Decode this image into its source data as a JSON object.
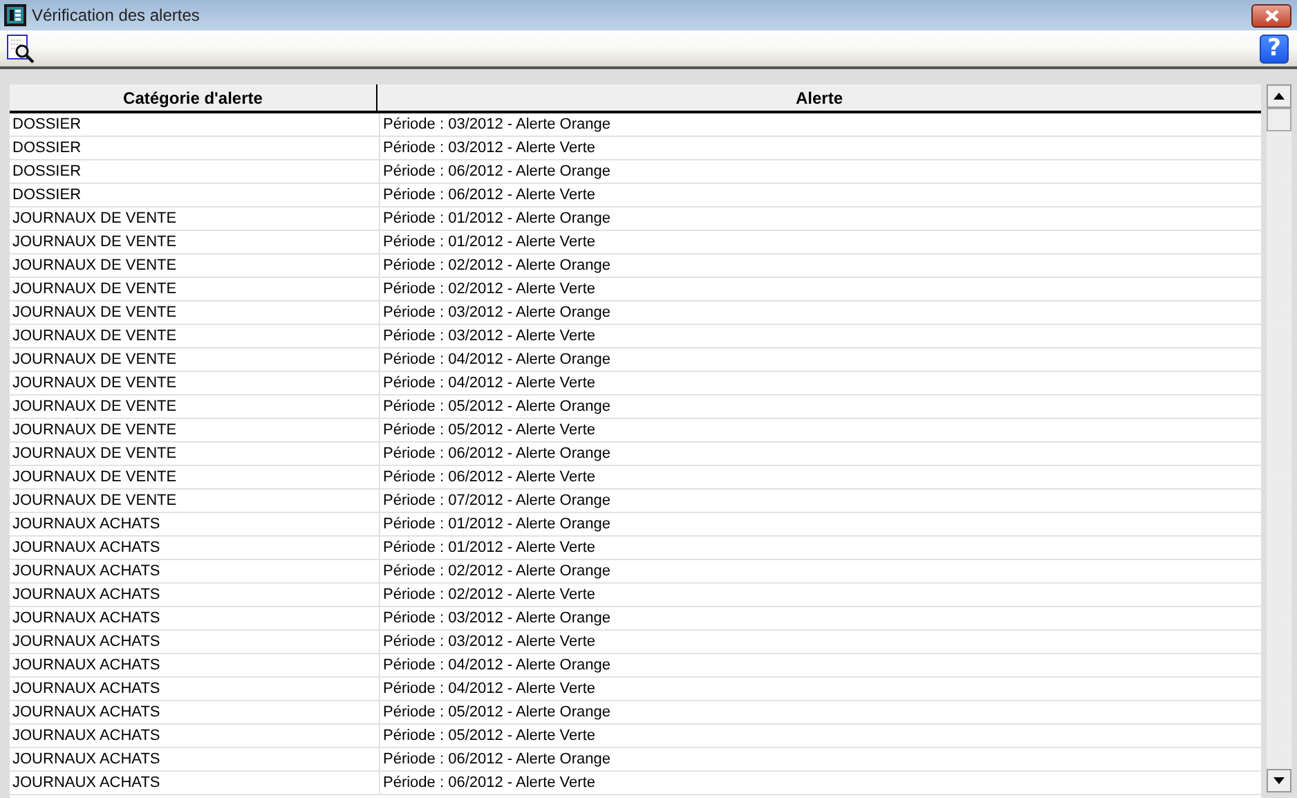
{
  "window": {
    "title": "Vérification des alertes"
  },
  "toolbar": {
    "help_button": "?"
  },
  "table": {
    "columns": [
      "Catégorie d'alerte",
      "Alerte"
    ],
    "rows": [
      [
        "DOSSIER",
        "Période : 03/2012 - Alerte Orange"
      ],
      [
        "DOSSIER",
        "Période : 03/2012 - Alerte Verte"
      ],
      [
        "DOSSIER",
        "Période : 06/2012 - Alerte Orange"
      ],
      [
        "DOSSIER",
        "Période : 06/2012 - Alerte Verte"
      ],
      [
        "JOURNAUX DE VENTE",
        "Période : 01/2012 - Alerte Orange"
      ],
      [
        "JOURNAUX DE VENTE",
        "Période : 01/2012 - Alerte Verte"
      ],
      [
        "JOURNAUX DE VENTE",
        "Période : 02/2012 - Alerte Orange"
      ],
      [
        "JOURNAUX DE VENTE",
        "Période : 02/2012 - Alerte Verte"
      ],
      [
        "JOURNAUX DE VENTE",
        "Période : 03/2012 - Alerte Orange"
      ],
      [
        "JOURNAUX DE VENTE",
        "Période : 03/2012 - Alerte Verte"
      ],
      [
        "JOURNAUX DE VENTE",
        "Période : 04/2012 - Alerte Orange"
      ],
      [
        "JOURNAUX DE VENTE",
        "Période : 04/2012 - Alerte Verte"
      ],
      [
        "JOURNAUX DE VENTE",
        "Période : 05/2012 - Alerte Orange"
      ],
      [
        "JOURNAUX DE VENTE",
        "Période : 05/2012 - Alerte Verte"
      ],
      [
        "JOURNAUX DE VENTE",
        "Période : 06/2012 - Alerte Orange"
      ],
      [
        "JOURNAUX DE VENTE",
        "Période : 06/2012 - Alerte Verte"
      ],
      [
        "JOURNAUX DE VENTE",
        "Période : 07/2012 - Alerte Orange"
      ],
      [
        "JOURNAUX ACHATS",
        "Période : 01/2012 - Alerte Orange"
      ],
      [
        "JOURNAUX ACHATS",
        "Période : 01/2012 - Alerte Verte"
      ],
      [
        "JOURNAUX ACHATS",
        "Période : 02/2012 - Alerte Orange"
      ],
      [
        "JOURNAUX ACHATS",
        "Période : 02/2012 - Alerte Verte"
      ],
      [
        "JOURNAUX ACHATS",
        "Période : 03/2012 - Alerte Orange"
      ],
      [
        "JOURNAUX ACHATS",
        "Période : 03/2012 - Alerte Verte"
      ],
      [
        "JOURNAUX ACHATS",
        "Période : 04/2012 - Alerte Orange"
      ],
      [
        "JOURNAUX ACHATS",
        "Période : 04/2012 - Alerte Verte"
      ],
      [
        "JOURNAUX ACHATS",
        "Période : 05/2012 - Alerte Orange"
      ],
      [
        "JOURNAUX ACHATS",
        "Période : 05/2012 - Alerte Verte"
      ],
      [
        "JOURNAUX ACHATS",
        "Période : 06/2012 - Alerte Orange"
      ],
      [
        "JOURNAUX ACHATS",
        "Période : 06/2012 - Alerte Verte"
      ]
    ]
  }
}
